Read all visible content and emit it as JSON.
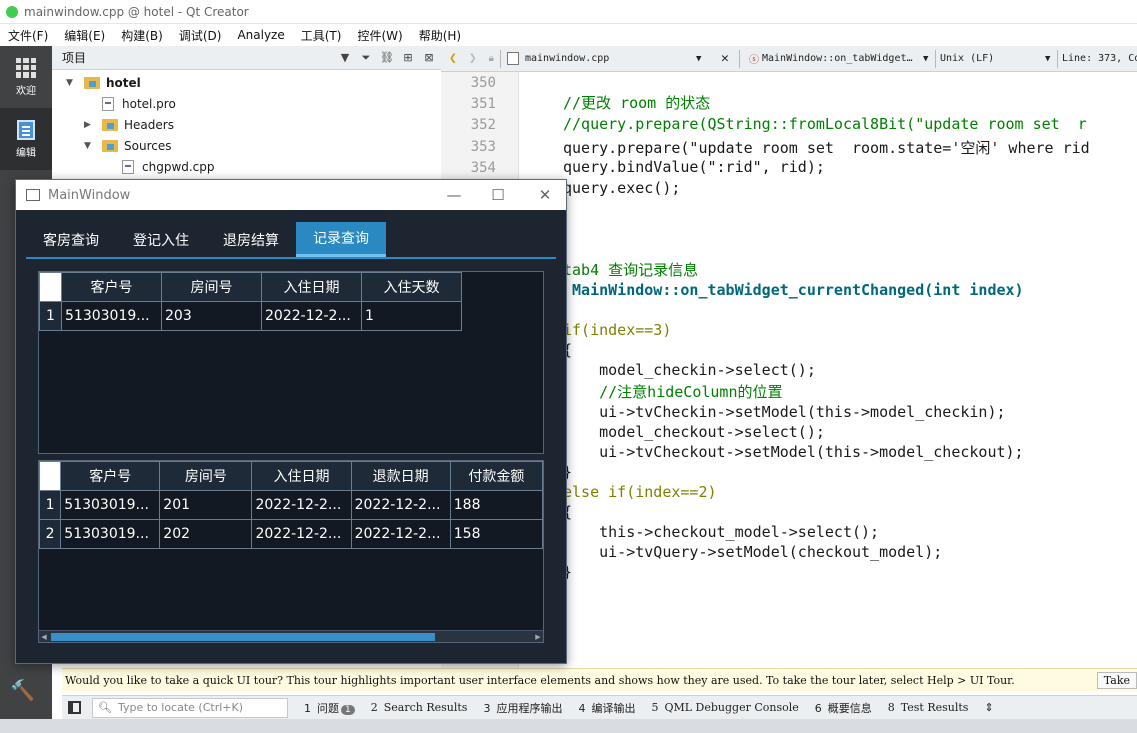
{
  "window_title": "mainwindow.cpp @ hotel - Qt Creator",
  "menu": [
    "文件(F)",
    "编辑(E)",
    "构建(B)",
    "调试(D)",
    "Analyze",
    "工具(T)",
    "控件(W)",
    "帮助(H)"
  ],
  "modes": [
    {
      "label": "欢迎",
      "icon": "grid-icon"
    },
    {
      "label": "编辑",
      "icon": "edit-document-icon"
    }
  ],
  "project": {
    "title": "项目",
    "tree": [
      {
        "label": "hotel",
        "type": "project-folder",
        "expanded": true
      },
      {
        "label": "hotel.pro",
        "type": "pro-file"
      },
      {
        "label": "Headers",
        "type": "folder",
        "expanded": false
      },
      {
        "label": "Sources",
        "type": "folder",
        "expanded": true
      },
      {
        "label": "chgpwd.cpp",
        "type": "cpp-file"
      }
    ]
  },
  "editor": {
    "file": "mainwindow.cpp",
    "function": "MainWindow::on_tabWidget…",
    "line_ending": "Unix (LF)",
    "position": "Line: 373, Co",
    "line_numbers": [
      "350",
      "351",
      "352",
      "353",
      "354"
    ]
  },
  "code_lines": [
    "",
    "//更改 room 的状态",
    "//query.prepare(QString::fromLocal8Bit(\"update room set  r",
    "query.prepare(\"update room set  room.state='空闲' where rid",
    "query.bindValue(\":rid\", rid);",
    "query.exec();",
    "",
    "",
    "",
    "tab4 查询记录信息",
    " MainWindow::on_tabWidget_currentChanged(int index)",
    "",
    "if(index==3)",
    "{",
    "    model_checkin->select();",
    "    //注意hideColumn的位置",
    "    ui->tvCheckin->setModel(this->model_checkin);",
    "    model_checkout->select();",
    "    ui->tvCheckout->setModel(this->model_checkout);",
    "}",
    "else if(index==2)",
    "{",
    "    this->checkout_model->select();",
    "    ui->tvQuery->setModel(checkout_model);",
    "}"
  ],
  "main_window": {
    "title": "MainWindow",
    "tabs": [
      "客房查询",
      "登记入住",
      "退房结算",
      "记录查询"
    ],
    "active_tab": 3,
    "checkin_table": {
      "headers": [
        "客户号",
        "房间号",
        "入住日期",
        "入住天数"
      ],
      "rows": [
        [
          "1",
          "51303019...",
          "203",
          "2022-12-2...",
          "1"
        ]
      ]
    },
    "checkout_table": {
      "headers": [
        "客户号",
        "房间号",
        "入住日期",
        "退款日期",
        "付款金额"
      ],
      "rows": [
        [
          "1",
          "51303019...",
          "201",
          "2022-12-2...",
          "2022-12-2...",
          "188"
        ],
        [
          "2",
          "51303019...",
          "202",
          "2022-12-2...",
          "2022-12-2...",
          "158"
        ]
      ]
    }
  },
  "infobar": {
    "text": "Would you like to take a quick UI tour? This tour highlights important user interface elements and shows how they are used. To take the tour later, select Help > UI Tour.",
    "button": "Take"
  },
  "statusbar": {
    "locate_placeholder": "Type to locate (Ctrl+K)",
    "tabs": [
      {
        "num": "1",
        "label": "问题",
        "badge": "1"
      },
      {
        "num": "2",
        "label": "Search Results"
      },
      {
        "num": "3",
        "label": "应用程序输出"
      },
      {
        "num": "4",
        "label": "编译输出"
      },
      {
        "num": "5",
        "label": "QML Debugger Console"
      },
      {
        "num": "6",
        "label": "概要信息"
      },
      {
        "num": "8",
        "label": "Test Results"
      }
    ]
  },
  "colors": {
    "accent_tab": "#2a89c0",
    "window_bg": "#1d2531",
    "ide_sidebar": "#404244",
    "comment": "#008000"
  }
}
